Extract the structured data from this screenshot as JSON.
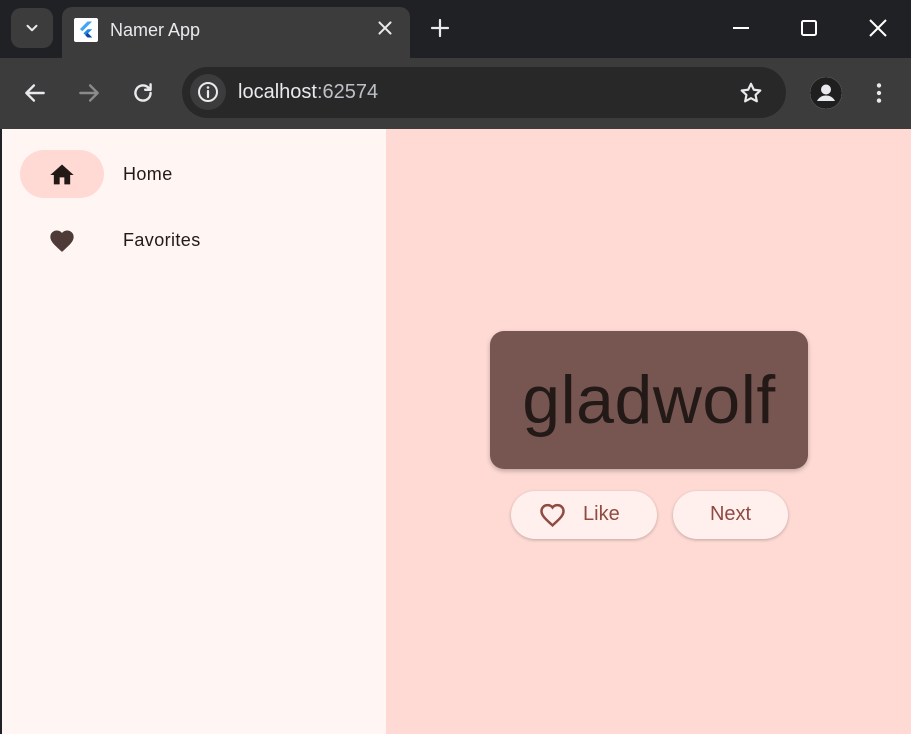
{
  "browser": {
    "tab_title": "Namer App",
    "url_host": "localhost",
    "url_port": ":62574"
  },
  "nav": {
    "items": [
      {
        "label": "Home",
        "icon": "home-icon",
        "active": true
      },
      {
        "label": "Favorites",
        "icon": "heart-icon",
        "active": false
      }
    ]
  },
  "main": {
    "word": "gladwolf",
    "like_label": "Like",
    "next_label": "Next"
  },
  "colors": {
    "nav_bg": "#fff5f3",
    "main_bg": "#ffdad4",
    "card_bg": "#775651",
    "button_bg": "#fff0ed",
    "accent": "#904a42",
    "active_indicator": "#ffdad4"
  }
}
